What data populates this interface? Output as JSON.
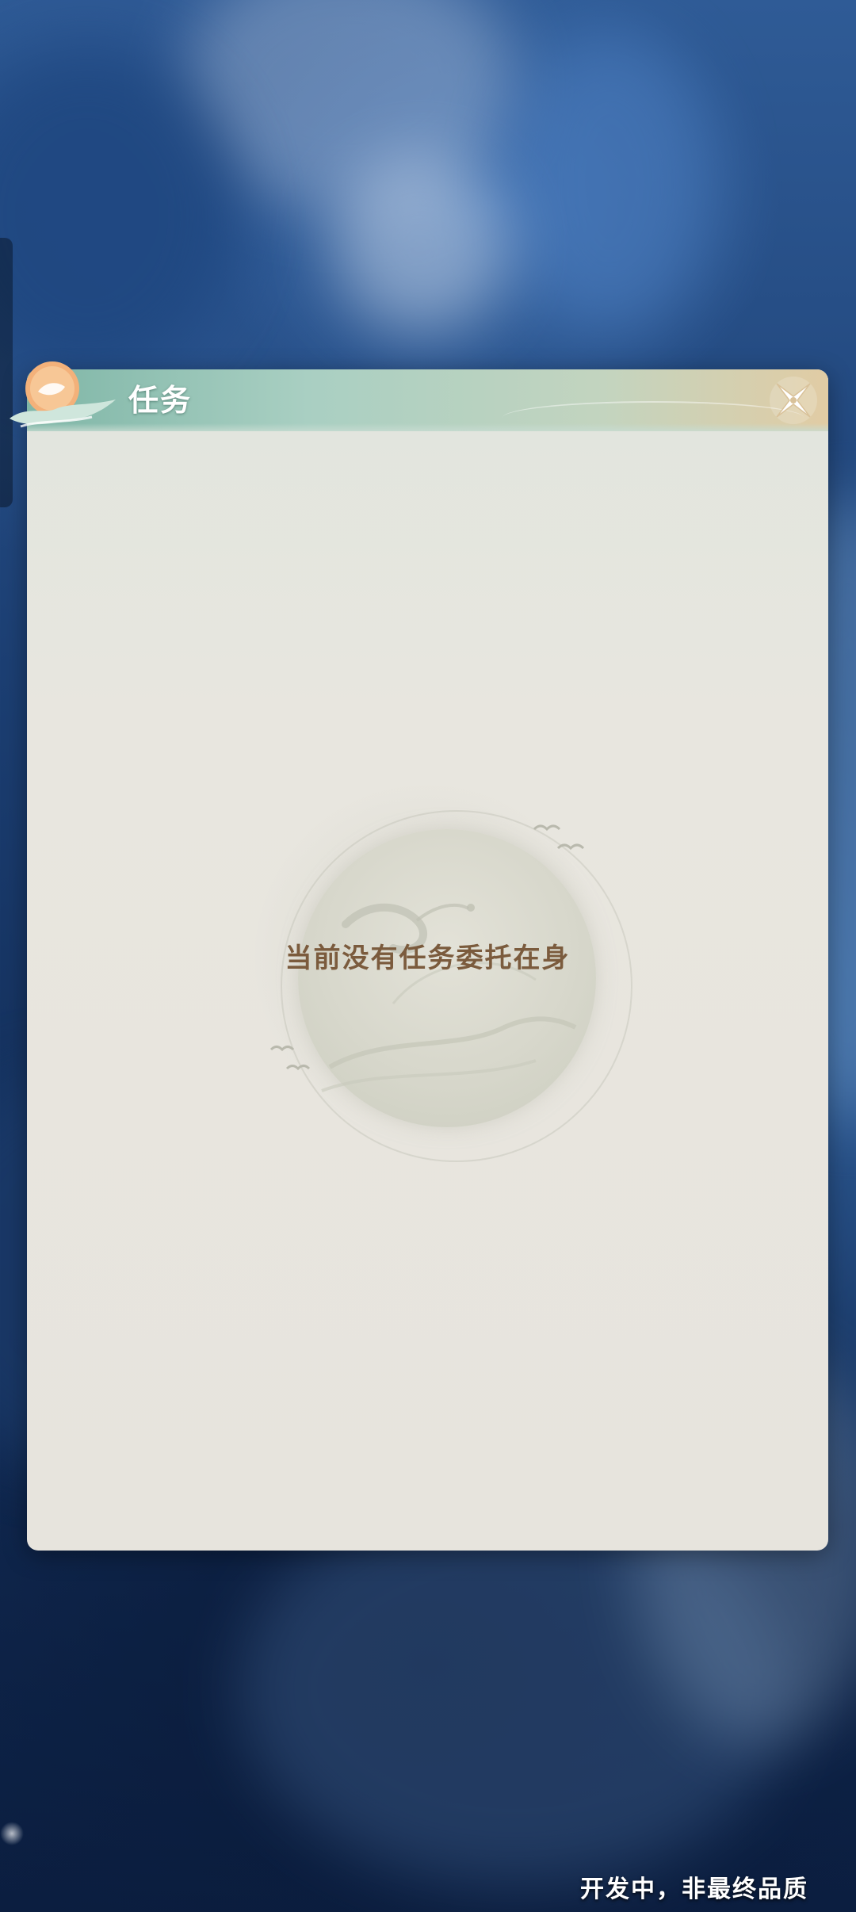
{
  "dialog": {
    "title": "任务",
    "close_icon": "close-x-icon",
    "title_ornament_icon": "moon-cloud-emblem-icon"
  },
  "empty_state": {
    "message": "当前没有任务委托在身",
    "illustration_icon": "crane-moon-illustration-icon"
  },
  "footer": {
    "watermark": "开发中，非最终品质"
  },
  "colors": {
    "header_start": "#7fb6a7",
    "header_end": "#e1cca4",
    "panel_background": "#e8e6df",
    "empty_text": "#7b5b3d"
  }
}
